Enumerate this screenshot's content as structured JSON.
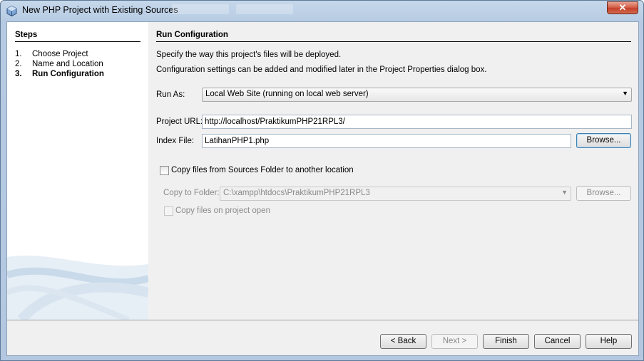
{
  "window": {
    "title": "New PHP Project with Existing Sources",
    "close_glyph": "✕"
  },
  "steps": {
    "heading": "Steps",
    "items": [
      {
        "num": "1.",
        "label": "Choose Project"
      },
      {
        "num": "2.",
        "label": "Name and Location"
      },
      {
        "num": "3.",
        "label": "Run Configuration"
      }
    ]
  },
  "content": {
    "heading": "Run Configuration",
    "desc1": "Specify the way this project's files will be deployed.",
    "desc2": "Configuration settings can be added and modified later in the Project Properties dialog box.",
    "run_as": {
      "label": "Run As:",
      "value": "Local Web Site (running on local web server)"
    },
    "project_url": {
      "label": "Project URL:",
      "value": "http://localhost/PraktikumPHP21RPL3/"
    },
    "index_file": {
      "label": "Index File:",
      "value": "LatihanPHP1.php",
      "browse": "Browse..."
    },
    "copy_files": {
      "label": "Copy files from Sources Folder to another location",
      "checked": false
    },
    "copy_to_folder": {
      "label": "Copy to Folder:",
      "value": "C:\\xampp\\htdocs\\PraktikumPHP21RPL3",
      "browse": "Browse..."
    },
    "copy_on_open": {
      "label": "Copy files on project open",
      "checked": false
    }
  },
  "buttons": {
    "back": "< Back",
    "next": "Next >",
    "finish": "Finish",
    "cancel": "Cancel",
    "help": "Help"
  },
  "colors": {
    "accent": "#3c7fb1",
    "close": "#c5412a"
  }
}
